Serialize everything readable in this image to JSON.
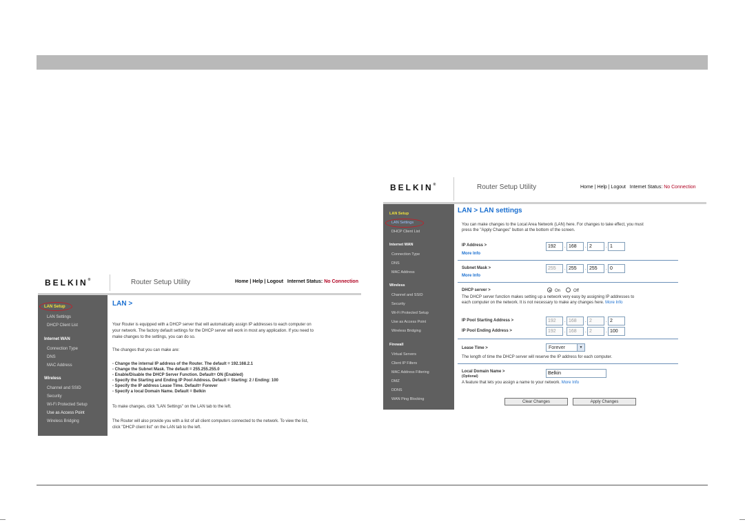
{
  "colors": {
    "topbar": "#b9b9b9",
    "sidebar": "#5f5f5f",
    "highlight": "#f2e33b",
    "accent_blue": "#1a6fd0",
    "no_connection": "#b00020",
    "circle": "#c0202a"
  },
  "left": {
    "logo": "BELKIN",
    "title": "Router Setup Utility",
    "links": [
      "Home",
      "Help",
      "Logout"
    ],
    "status_label": "Internet Status:",
    "status_value": "No Connection",
    "sidebar": {
      "lan": "LAN Setup",
      "lan_items": [
        "LAN Settings",
        "DHCP Client List"
      ],
      "wan": "Internet WAN",
      "wan_items": [
        "Connection Type",
        "DNS",
        "MAC Address"
      ],
      "wireless": "Wireless",
      "wireless_items": [
        "Channel and SSID",
        "Security",
        "Wi-Fi Protected Setup",
        "Use as Access Point",
        "Wireless Bridging"
      ]
    },
    "heading": "LAN >",
    "intro": [
      "Your Router is equipped with a DHCP server that will automatically assign IP addresses to each computer on",
      "your network. The factory default settings for the DHCP server will work in most any application. If you need to",
      "make changes to the settings, you can do so."
    ],
    "changes_title": "The changes that you can make are:",
    "changes": [
      "- Change the internal IP address of the Router. The default = 192.168.2.1",
      "- Change the Subnet Mask. The default = 255.255.255.0",
      "- Enable/Disable the DHCP Server Function. Default= ON (Enabled)",
      "- Specify the Starting and Ending IP Pool Address. Default = Starting: 2 / Ending: 100",
      "- Specify the IP address Lease Time. Default= Forever",
      "- Specify a local Domain Name. Default = Belkin"
    ],
    "to_make": "To make changes, click \"LAN Settings\" on the LAN tab to the left.",
    "provide": [
      "The Router will also provide you with a list of all client computers connected to the network. To view the list,",
      "click \"DHCP client list\" on the LAN tab to the left."
    ]
  },
  "right": {
    "logo": "BELKIN",
    "title": "Router Setup Utility",
    "links": [
      "Home",
      "Help",
      "Logout"
    ],
    "status_label": "Internet Status:",
    "status_value": "No Connection",
    "sidebar": {
      "lan": "LAN Setup",
      "lan_items": [
        "LAN Settings",
        "DHCP Client List"
      ],
      "wan": "Internet WAN",
      "wan_items": [
        "Connection Type",
        "DNS",
        "MAC Address"
      ],
      "wireless": "Wireless",
      "wireless_items": [
        "Channel and SSID",
        "Security",
        "Wi-Fi Protected Setup",
        "Use as Access Point",
        "Wireless Bridging"
      ],
      "firewall": "Firewall",
      "firewall_items": [
        "Virtual Servers",
        "Client IP Filters",
        "MAC Address Filtering",
        "DMZ",
        "DDNS",
        "WAN Ping Blocking"
      ]
    },
    "heading": "LAN > LAN settings",
    "intro": [
      "You can make changes to the Local Area Network (LAN) here. For changes to take effect, you must",
      "press the \"Apply Changes\" button at the bottom of the screen."
    ],
    "ip_label": "IP Address >",
    "ip": [
      "192",
      "168",
      "2",
      "1"
    ],
    "more_info": "More Info",
    "mask_label": "Subnet Mask >",
    "mask": [
      "255",
      "255",
      "255",
      "0"
    ],
    "dhcp_label": "DHCP server >",
    "dhcp_on": "On",
    "dhcp_off": "Off",
    "dhcp_desc": [
      "The DHCP server function makes setting up a network very easy by assigning IP addresses to",
      "each computer on the network. It is not necessary to make any changes here."
    ],
    "pool_start_label": "IP Pool Starting Address >",
    "pool_start": [
      "192",
      "168",
      "2",
      "2"
    ],
    "pool_end_label": "IP Pool Ending Address >",
    "pool_end": [
      "192",
      "168",
      "2",
      "100"
    ],
    "lease_label": "Lease Time >",
    "lease_value": "Forever",
    "lease_desc": "The length of time the DHCP server will reserve the IP address for each computer.",
    "domain_label": "Local Domain Name >",
    "domain_optional": "(Optional)",
    "domain_value": "Belkin",
    "domain_desc": "A feature that lets you assign a name to your network.",
    "clear_btn": "Clear Changes",
    "apply_btn": "Apply Changes"
  }
}
